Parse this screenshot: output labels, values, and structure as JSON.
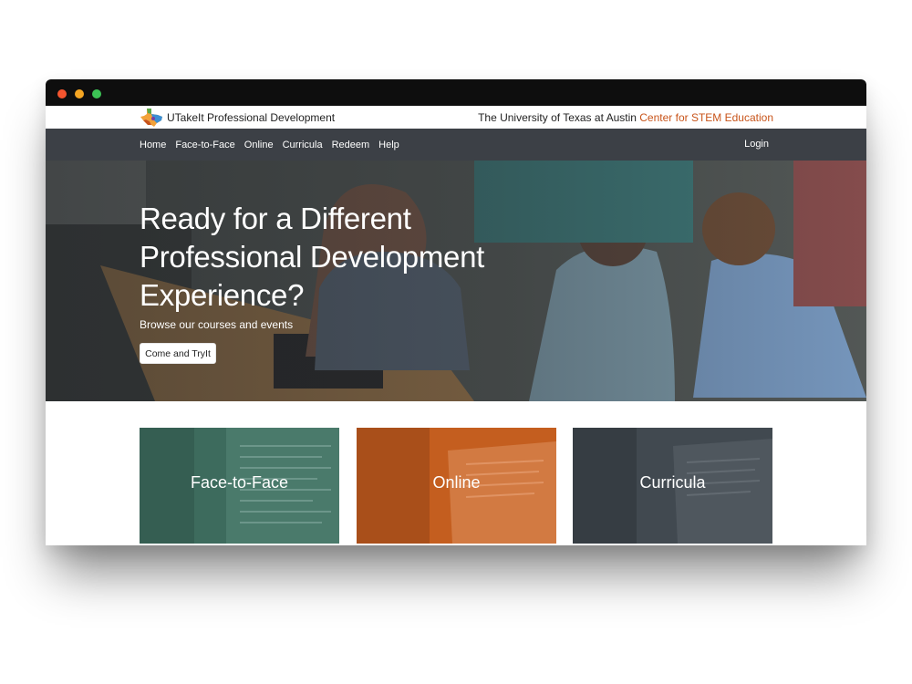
{
  "window": {
    "controls": [
      "close",
      "minimize",
      "maximize"
    ]
  },
  "header": {
    "brand": "UTakeIt Professional Development",
    "logo_icon": "texas-map-logo-icon",
    "university": "The University of Texas at Austin",
    "center": "Center for STEM Education",
    "center_color": "#c8541a"
  },
  "nav": {
    "items": [
      "Home",
      "Face-to-Face",
      "Online",
      "Curricula",
      "Redeem",
      "Help"
    ],
    "login": "Login",
    "background": "#3c4046"
  },
  "hero": {
    "title_lines": [
      "Ready for a Different",
      "Professional Development",
      "Experience?"
    ],
    "subtitle": "Browse our courses and events",
    "button": "Come and TryIt"
  },
  "cards": [
    {
      "label": "Face-to-Face",
      "color": "#3d6b5d"
    },
    {
      "label": "Online",
      "color": "#c45e1f"
    },
    {
      "label": "Curricula",
      "color": "#414950"
    }
  ]
}
